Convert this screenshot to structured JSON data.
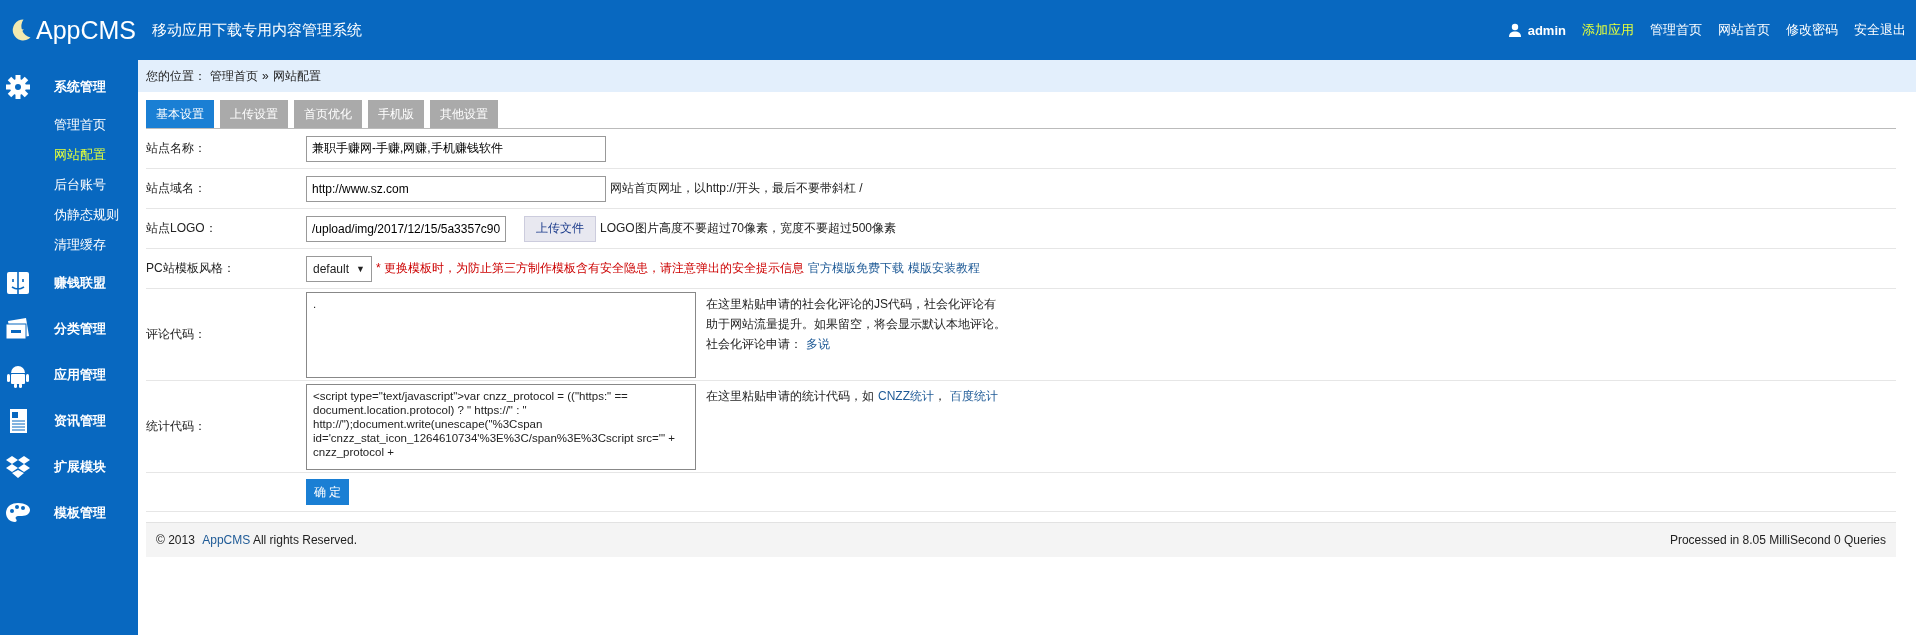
{
  "header": {
    "logo": "AppCMS",
    "subtitle": "移动应用下载专用内容管理系统",
    "user": "admin",
    "links": [
      {
        "label": "添加应用",
        "highlighted": true
      },
      {
        "label": "管理首页",
        "highlighted": false
      },
      {
        "label": "网站首页",
        "highlighted": false
      },
      {
        "label": "修改密码",
        "highlighted": false
      },
      {
        "label": "安全退出",
        "highlighted": false
      }
    ]
  },
  "sidebar": {
    "items": [
      {
        "label": "系统管理",
        "kind": "gear",
        "children": [
          {
            "label": "管理首页",
            "selected": false
          },
          {
            "label": "网站配置",
            "selected": true
          },
          {
            "label": "后台账号",
            "selected": false
          },
          {
            "label": "伪静态规则",
            "selected": false
          },
          {
            "label": "清理缓存",
            "selected": false
          }
        ]
      },
      {
        "label": "赚钱联盟",
        "kind": "face"
      },
      {
        "label": "分类管理",
        "kind": "cards"
      },
      {
        "label": "应用管理",
        "kind": "android"
      },
      {
        "label": "资讯管理",
        "kind": "document"
      },
      {
        "label": "扩展模块",
        "kind": "boxes"
      },
      {
        "label": "模板管理",
        "kind": "palette"
      }
    ]
  },
  "breadcrumb": {
    "prefix": "您的位置：",
    "items": [
      "管理首页",
      "网站配置"
    ],
    "separator": "»"
  },
  "tabs": [
    {
      "label": "基本设置",
      "selected": true
    },
    {
      "label": "上传设置",
      "selected": false
    },
    {
      "label": "首页优化",
      "selected": false
    },
    {
      "label": "手机版",
      "selected": false
    },
    {
      "label": "其他设置",
      "selected": false
    }
  ],
  "form": {
    "rows": [
      {
        "kind": "text",
        "label": "站点名称：",
        "value": "兼职手赚网-手赚,网赚,手机赚钱软件"
      },
      {
        "kind": "text",
        "label": "站点域名：",
        "value": "http://www.sz.com",
        "hint": [
          {
            "text": "网站首页网址，以http://开头，最后不要带斜杠 /"
          }
        ]
      },
      {
        "kind": "file",
        "label": "站点LOGO：",
        "value": "/upload/img/2017/12/15/5a3357c90",
        "button": "上传文件",
        "hint": [
          {
            "text": "LOGO图片高度不要超过70像素，宽度不要超过500像素"
          }
        ]
      },
      {
        "kind": "select",
        "label": "PC站模板风格：",
        "value": "default",
        "arrow": "▼",
        "hint": [
          {
            "text": "* 更换模板时，为防止第三方制作模板含有安全隐患，请注意弹出的安全提示信息",
            "kind": "warning"
          },
          {
            "text": "官方模版免费下载",
            "kind": "link"
          },
          {
            "text": "模版安装教程",
            "kind": "link"
          }
        ]
      },
      {
        "kind": "textarea",
        "label": "评论代码：",
        "value": ".",
        "hint": [
          {
            "text": "在这里粘贴申请的社会化评论的JS代码，社会化评论有助于网站流量提升。如果留空，将会显示默认本地评论。社会化评论申请："
          },
          {
            "text": "多说",
            "kind": "link"
          }
        ]
      },
      {
        "kind": "textarea",
        "label": "统计代码：",
        "value": "<script type=\"text/javascript\">var cnzz_protocol = ((\"https:\" == document.location.protocol) ? \" https://\" : \" http://\");document.write(unescape(\"%3Cspan id='cnzz_stat_icon_1264610734'%3E%3C/span%3E%3Cscript src='\" + cnzz_protocol +",
        "hint": [
          {
            "text": "在这里粘贴申请的统计代码，如"
          },
          {
            "text": "CNZZ统计",
            "kind": "link"
          },
          {
            "text": "，"
          },
          {
            "text": "百度统计",
            "kind": "link"
          }
        ]
      }
    ],
    "submit": "确 定"
  },
  "footer": {
    "copyright": "© 2013",
    "brand": "AppCMS",
    "rights": "All rights Reserved.",
    "stats": "Processed in 8.05 MilliSecond 0 Queries"
  }
}
